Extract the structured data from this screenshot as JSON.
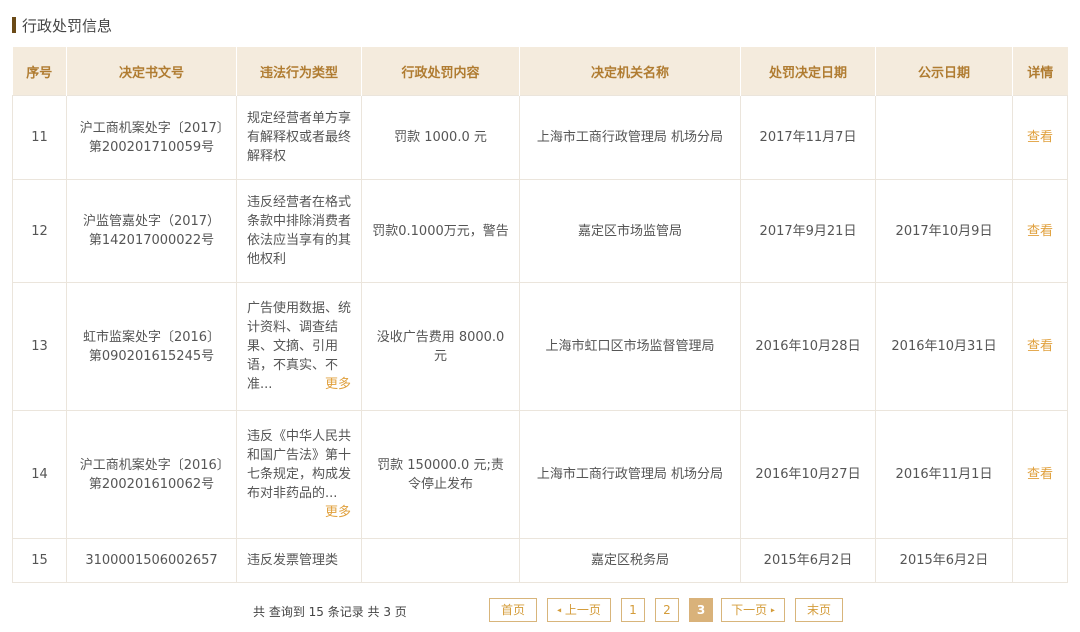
{
  "section_title": "行政处罚信息",
  "table": {
    "headers": [
      "序号",
      "决定书文号",
      "违法行为类型",
      "行政处罚内容",
      "决定机关名称",
      "处罚决定日期",
      "公示日期",
      "详情"
    ],
    "rows": [
      {
        "no": "11",
        "doc": "沪工商机案处字〔2017〕第200201710059号",
        "type": "规定经营者单方享有解释权或者最终解释权",
        "more": "",
        "content": "罚款 1000.0 元",
        "org": "上海市工商行政管理局 机场分局",
        "decision_date": "2017年11月7日",
        "publish_date": "",
        "detail": "查看"
      },
      {
        "no": "12",
        "doc": "沪监管嘉处字（2017）第142017000022号",
        "type": "违反经营者在格式条款中排除消费者依法应当享有的其他权利",
        "more": "",
        "content": "罚款0.1000万元，警告",
        "org": "嘉定区市场监管局",
        "decision_date": "2017年9月21日",
        "publish_date": "2017年10月9日",
        "detail": "查看"
      },
      {
        "no": "13",
        "doc": "虹市监案处字〔2016〕第090201615245号",
        "type": "广告使用数据、统计资料、调查结果、文摘、引用语，不真实、不准...",
        "more": "更多",
        "content": "没收广告费用 8000.0 元",
        "org": "上海市虹口区市场监督管理局",
        "decision_date": "2016年10月28日",
        "publish_date": "2016年10月31日",
        "detail": "查看"
      },
      {
        "no": "14",
        "doc": "沪工商机案处字〔2016〕第200201610062号",
        "type": "违反《中华人民共和国广告法》第十七条规定，构成发布对非药品的...",
        "more": "更多",
        "content": "罚款 150000.0 元;责令停止发布",
        "org": "上海市工商行政管理局 机场分局",
        "decision_date": "2016年10月27日",
        "publish_date": "2016年11月1日",
        "detail": "查看"
      },
      {
        "no": "15",
        "doc": "3100001506002657",
        "type": "违反发票管理类",
        "more": "",
        "content": "",
        "org": "嘉定区税务局",
        "decision_date": "2015年6月2日",
        "publish_date": "2015年6月2日",
        "detail": ""
      }
    ]
  },
  "pager": {
    "summary": "共 查询到 15 条记录 共 3 页",
    "first": "首页",
    "prev": "上一页",
    "pages": [
      "1",
      "2",
      "3"
    ],
    "current": "3",
    "next": "下一页",
    "last": "末页",
    "prev_icon": "◂",
    "next_icon": "▸"
  },
  "colors": {
    "header_bg": "#f4ebdd",
    "header_text": "#b07c31",
    "accent": "#e0a03d",
    "active_page": "#d9b27a"
  }
}
